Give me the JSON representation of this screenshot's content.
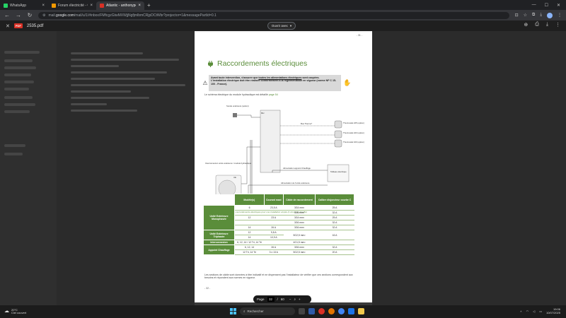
{
  "browser": {
    "tabs": [
      {
        "label": "WhatsApp",
        "color": "#25d366",
        "active": false
      },
      {
        "label": "Forum électricité - Conseils ...",
        "color": "#f29900",
        "active": false
      },
      {
        "label": "Atlantic - anthonyperie12@...",
        "color": "#d93025",
        "active": true
      }
    ],
    "url_prefix": "mail.",
    "url_domain": "google.com",
    "url_rest": "/mail/u/1/#inbox/FMfcgzGtwMXWjjNgfjmlbmCRjpDCtWbr?projector=1&messagePartId=0.1"
  },
  "pdf": {
    "file_name": "2535.pdf",
    "open_with": "Ouvrir avec",
    "page_top_label": "- 31 -",
    "title": "Raccordements électriques",
    "warning_line1_pre": "Avant toute intervention, s'assurer que ",
    "warning_line1_u": "toutes les alimentations électriques",
    "warning_line1_post": " sont coupées.",
    "warning_line2": "L'installation électrique doit être réalisée conformément à la réglementation en vigueur (norme NF C 15-100 - France).",
    "schema_ref_pre": "Le schéma électrique du module hydraulique est détaillé ",
    "schema_ref_link": "page 54",
    "diagram_labels": {
      "sonde": "Sonde extérieure (option)",
      "mh": "MH",
      "inter": "Interconnexion unité extérieure / module hydraulique",
      "ue": "UE",
      "bus": "Bus Thermo*",
      "th1": "Thermostat 225 (option)",
      "th2": "Thermostat 223 (option)",
      "th3": "Thermostat 100 (option)",
      "alim_appoint": "Alimentation appoint Chauffage",
      "tableau": "Tableau électrique",
      "alim_ue": "Alimentation de l'unité extérieure"
    },
    "caption": "fig. 37 - Schéma d'ensemble des raccordements électriques pour une installation simple (1 circuit de chauffe)",
    "table": {
      "headers": [
        "Modèle(s)",
        "Courant maxi",
        "Câble de raccordement",
        "Calibre disjoncteur courbe C"
      ],
      "rows": [
        [
          "6",
          "23,5 A",
          "3G4 mm²",
          "25 A"
        ],
        [
          "",
          "",
          "3G6 mm²",
          "32 A"
        ],
        [
          "12",
          "23 A",
          "3G4 mm²",
          "25 A"
        ],
        [
          "",
          "",
          "3G6 mm²",
          "32 A"
        ],
        [
          "14",
          "26 A",
          "3G6 mm²",
          "32 A"
        ],
        [
          "12",
          "9,8 A",
          "5G2,5 mm²",
          "16 A"
        ],
        [
          "14",
          "10,9 A",
          "",
          ""
        ],
        [
          "6, 12, 14 / 12 Tri, 14 Tri",
          "",
          "4G1,5 mm²",
          ""
        ],
        [
          "6, 12, 14",
          "26 A",
          "3G6 mm²",
          "32 A"
        ],
        [
          "12 Tri, 14 Tri",
          "3 x 13 A",
          "5G2,5 mm²",
          "20 A"
        ]
      ],
      "groups": [
        "Unité Extérieure Monophasée",
        "Unité Extérieure Triphasée",
        "Interconnexion",
        "Appoint Chauffage"
      ]
    },
    "footnote": "Les sections de câble sont données à titre indicatif et ne dispensent pas l'installateur de vérifier que ces sections correspondent aux besoins et répondent aux normes en vigueur.",
    "page_bottom_label": "- 32 -"
  },
  "pagectl": {
    "label": "Page",
    "current": "32",
    "sep": "/",
    "total": "60"
  },
  "taskbar": {
    "temp": "20°C",
    "weather": "Ciel couvert",
    "search": "Rechercher",
    "time": "19:06",
    "date": "10/07/2025"
  },
  "colors": {
    "accent": "#5a8d3a",
    "pdf_red": "#d93025"
  }
}
